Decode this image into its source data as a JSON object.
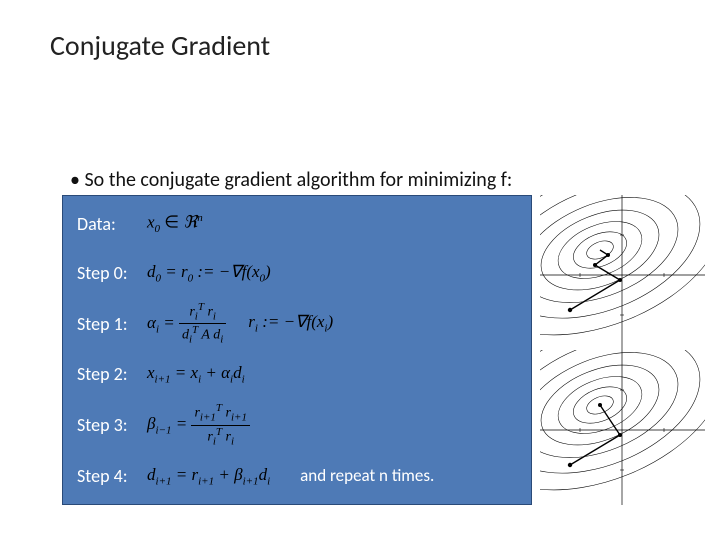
{
  "title": "Conjugate Gradient",
  "bullet": "• So the conjugate gradient algorithm for minimizing f:",
  "steps": {
    "data_label": "Data:",
    "s0_label": "Step 0:",
    "s1_label": "Step 1:",
    "s2_label": "Step 2:",
    "s3_label": "Step 3:",
    "s4_label": "Step 4:"
  },
  "math": {
    "data_expr": "x0 ∈ ℜn",
    "s0_expr": "d0 = r0 := −∇f(x0)",
    "s1_alpha": "αi = (riT ri) / (diT A di)",
    "s1_r": "ri := −∇f(xi)",
    "s2_expr": "xi+1 = xi + αi di",
    "s3_expr": "βi−1 = (ri+1T ri+1) / (riT ri)",
    "s4_expr": "di+1 = ri+1 + βi+1 di"
  },
  "note": "and repeat n times."
}
